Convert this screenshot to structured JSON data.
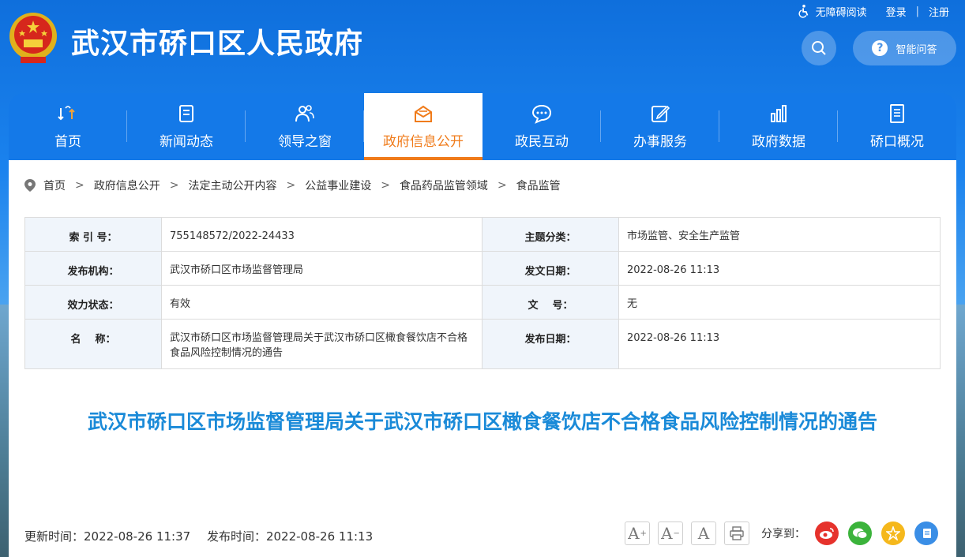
{
  "header": {
    "site_title": "武汉市硚口区人民政府",
    "accessibility": "无障碍阅读",
    "login": "登录",
    "register": "注册",
    "qa_label": "智能问答"
  },
  "nav": {
    "items": [
      {
        "label": "首页"
      },
      {
        "label": "新闻动态"
      },
      {
        "label": "领导之窗"
      },
      {
        "label": "政府信息公开"
      },
      {
        "label": "政民互动"
      },
      {
        "label": "办事服务"
      },
      {
        "label": "政府数据"
      },
      {
        "label": "硚口概况"
      }
    ],
    "active_index": 3,
    "active_color": "#f07b1a"
  },
  "breadcrumb": [
    "首页",
    "政府信息公开",
    "法定主动公开内容",
    "公益事业建设",
    "食品药品监管领域",
    "食品监管"
  ],
  "meta": {
    "index_no_label": "索 引 号：",
    "index_no": "755148572/2022-24433",
    "topic_label": "主题分类：",
    "topic": "市场监管、安全生产监管",
    "publisher_label": "发布机构：",
    "publisher": "武汉市硚口区市场监督管理局",
    "issue_date_label": "发文日期：",
    "issue_date": "2022-08-26 11:13",
    "status_label": "效力状态：",
    "status": "有效",
    "doc_no_label": "文    号：",
    "doc_no": "无",
    "name_label": "名    称：",
    "name": "武汉市硚口区市场监督管理局关于武汉市硚口区橄食餐饮店不合格食品风险控制情况的通告",
    "publish_date_label": "发布日期：",
    "publish_date": "2022-08-26 11:13"
  },
  "document": {
    "title": "武汉市硚口区市场监督管理局关于武汉市硚口区橄食餐饮店不合格食品风险控制情况的通告",
    "updated": "更新时间：2022-08-26 11:37",
    "published": "发布时间：2022-08-26 11:13"
  },
  "tools": {
    "font_increase": "A",
    "font_decrease": "A",
    "font_reset": "A"
  },
  "share": {
    "label": "分享到："
  },
  "colors": {
    "brand_blue": "#1479e8",
    "title_blue": "#1a8ad8"
  }
}
